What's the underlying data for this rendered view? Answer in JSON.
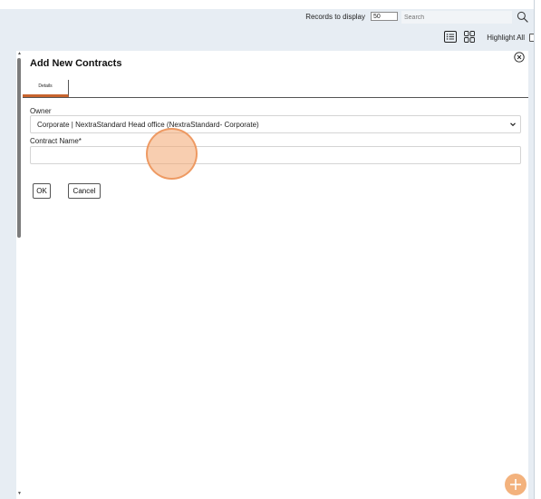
{
  "toolbar": {
    "records_label": "Records to display",
    "records_value": "50",
    "search_placeholder": "Search",
    "highlight_all_label": "Highlight All"
  },
  "modal": {
    "title": "Add New Contracts",
    "tabs": [
      {
        "label": "Details",
        "active": true
      }
    ],
    "fields": {
      "owner": {
        "label": "Owner",
        "value": "Corporate | NextraStandard Head office (NextraStandard- Corporate)"
      },
      "contract_name": {
        "label": "Contract Name*",
        "value": ""
      }
    },
    "buttons": {
      "ok": "OK",
      "cancel": "Cancel"
    }
  },
  "colors": {
    "tab_accent": "#c8642e",
    "fab": "#f3b27d",
    "background": "#e7edf3"
  },
  "icons": [
    "search-icon",
    "list-view-icon",
    "grid-view-icon",
    "close-icon",
    "chevron-down-icon",
    "add-icon"
  ]
}
